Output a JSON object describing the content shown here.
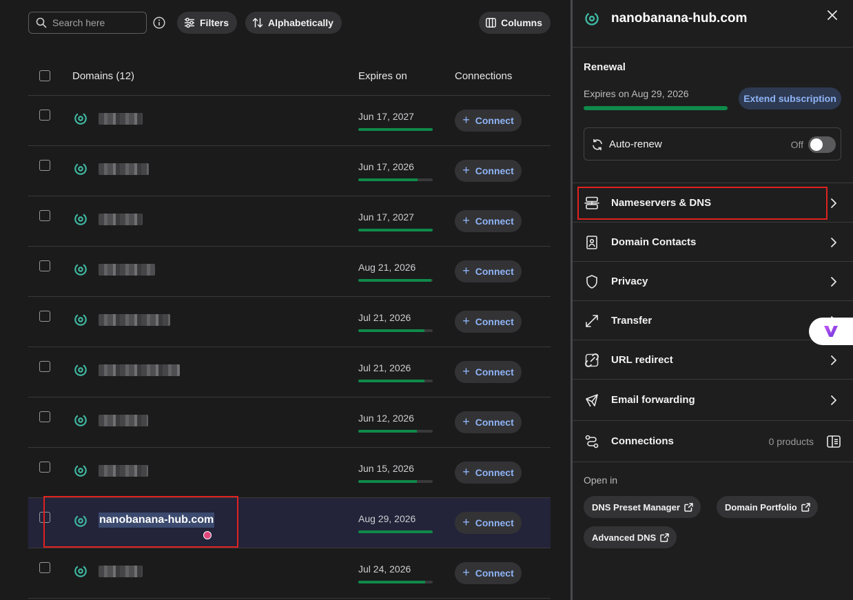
{
  "toolbar": {
    "search_placeholder": "Search here",
    "filters_label": "Filters",
    "sort_label": "Alphabetically",
    "columns_label": "Columns"
  },
  "table": {
    "headers": {
      "domains": "Domains (12)",
      "expires": "Expires on",
      "connections": "Connections"
    },
    "connect_label": "Connect",
    "rows": [
      {
        "name_redacted": true,
        "expires": "Jun 17, 2027",
        "progress": 1.0
      },
      {
        "name_redacted": true,
        "expires": "Jun 17, 2026",
        "progress": 0.8
      },
      {
        "name_redacted": true,
        "expires": "Jun 17, 2027",
        "progress": 1.0
      },
      {
        "name_redacted": true,
        "expires": "Aug 21, 2026",
        "progress": 0.98
      },
      {
        "name_redacted": true,
        "expires": "Jul 21, 2026",
        "progress": 0.89
      },
      {
        "name_redacted": true,
        "expires": "Jul 21, 2026",
        "progress": 0.89
      },
      {
        "name_redacted": true,
        "expires": "Jun 12, 2026",
        "progress": 0.79
      },
      {
        "name_redacted": true,
        "expires": "Jun 15, 2026",
        "progress": 0.79
      },
      {
        "name": "nanobanana-hub.com",
        "expires": "Aug 29, 2026",
        "progress": 1.0,
        "selected": true
      },
      {
        "name_redacted": true,
        "expires": "Jul 24, 2026",
        "progress": 0.9
      }
    ]
  },
  "panel": {
    "title": "nanobanana-hub.com",
    "renewal": {
      "heading": "Renewal",
      "expires_text": "Expires on Aug 29, 2026",
      "progress": 1.0,
      "extend_label": "Extend subscription",
      "autorenew_label": "Auto-renew",
      "autorenew_state": "Off"
    },
    "menu": [
      {
        "label": "Nameservers & DNS",
        "icon": "server-icon"
      },
      {
        "label": "Domain Contacts",
        "icon": "contact-book-icon"
      },
      {
        "label": "Privacy",
        "icon": "shield-icon"
      },
      {
        "label": "Transfer",
        "icon": "transfer-arrows-icon"
      },
      {
        "label": "URL redirect",
        "icon": "link-redirect-icon"
      },
      {
        "label": "Email forwarding",
        "icon": "email-forward-icon"
      },
      {
        "label": "Connections",
        "icon": "connections-icon",
        "sub": "0 products"
      }
    ],
    "open_in_label": "Open in",
    "open_in": [
      "DNS Preset Manager",
      "Domain Portfolio",
      "Advanced DNS"
    ]
  },
  "colors": {
    "accent_blue": "#8fb4f7",
    "progress_green": "#0f8a49",
    "domain_icon_teal": "#3fb9a0",
    "highlight_red": "#e0221f"
  }
}
